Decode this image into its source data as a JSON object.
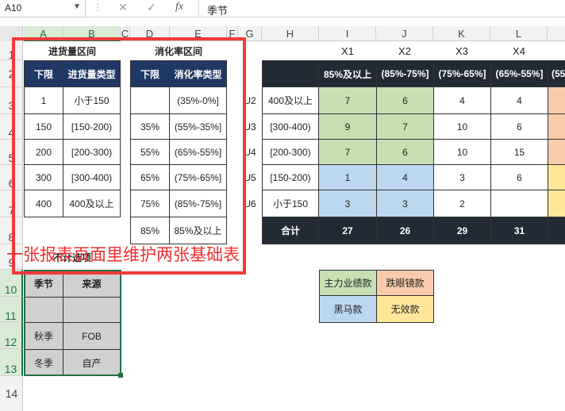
{
  "formula_bar": {
    "name_box": "A10",
    "cancel_icon": "✕",
    "enter_icon": "✓",
    "fx_label": "fx",
    "formula": "季节"
  },
  "columns": [
    "A",
    "B",
    "C",
    "D",
    "E",
    "F",
    "G",
    "H",
    "I",
    "J",
    "K",
    "L"
  ],
  "rows": [
    "1",
    "2",
    "3",
    "4",
    "5",
    "6",
    "7",
    "8",
    "9",
    "10",
    "11",
    "12",
    "13",
    "14"
  ],
  "stock_table": {
    "title": "进货量区间",
    "headers": [
      "下限",
      "进货量类型"
    ],
    "rows": [
      [
        "1",
        "小于150"
      ],
      [
        "150",
        "[150-200)"
      ],
      [
        "200",
        "[200-300)"
      ],
      [
        "300",
        "[300-400)"
      ],
      [
        "400",
        "400及以上"
      ]
    ]
  },
  "sellthrough_table": {
    "title": "消化率区间",
    "headers": [
      "下限",
      "消化率类型"
    ],
    "rows": [
      [
        "",
        "(35%-0%]"
      ],
      [
        "35%",
        "(55%-35%]"
      ],
      [
        "55%",
        "(65%-55%]"
      ],
      [
        "65%",
        "(75%-65%]"
      ],
      [
        "75%",
        "(85%-75%]"
      ],
      [
        "85%",
        "85%及以上"
      ]
    ]
  },
  "exclude_table": {
    "title": "不计选项",
    "headers": [
      "季节",
      "来源"
    ],
    "rows": [
      [
        "",
        ""
      ],
      [
        "秋季",
        "FOB"
      ],
      [
        "冬季",
        "自产"
      ]
    ]
  },
  "annotation": "一张报表页面里维护两张基础表",
  "matrix": {
    "x_labels": [
      "X1",
      "X2",
      "X3",
      "X4"
    ],
    "col_headers": [
      "85%及以上",
      "(85%-75%]",
      "(75%-65%]",
      "(65%-55%]",
      "(55"
    ],
    "g_labels": [
      "U2",
      "U3",
      "U4",
      "U5",
      "U6"
    ],
    "row_labels": [
      "400及以上",
      "[300-400)",
      "[200-300)",
      "[150-200)",
      "小于150"
    ],
    "values": [
      [
        "7",
        "6",
        "4",
        "4"
      ],
      [
        "9",
        "7",
        "10",
        "6"
      ],
      [
        "7",
        "6",
        "10",
        "15"
      ],
      [
        "1",
        "4",
        "3",
        "6"
      ],
      [
        "3",
        "3",
        "2",
        ""
      ]
    ],
    "total_label": "合计",
    "totals": [
      "27",
      "26",
      "29",
      "31"
    ]
  },
  "legend": {
    "items": [
      "主力业绩款",
      "跌眼镜款",
      "黑马款",
      "无效款"
    ],
    "colors": [
      "#c6e0b4",
      "#f8cbad",
      "#bdd7ee",
      "#ffe699"
    ]
  }
}
